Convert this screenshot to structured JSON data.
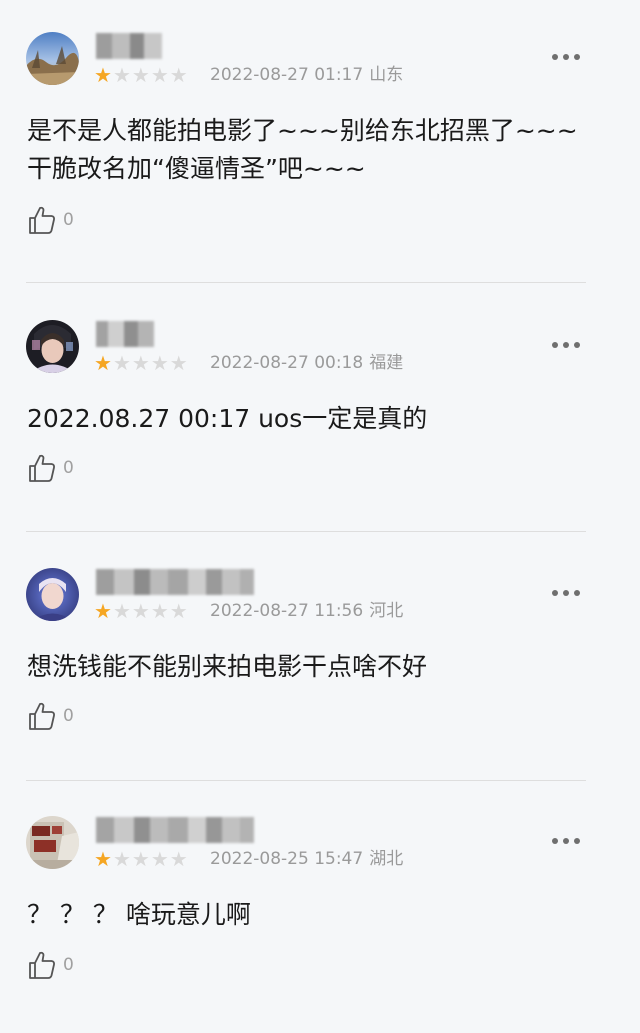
{
  "comments": [
    {
      "rating": 1,
      "date": "2022-08-27 01:17",
      "region": "山东",
      "text": "是不是人都能拍电影了~~~别给东北招黑了~~~\n干脆改名加“傻逼情圣”吧~~~",
      "likes": "0"
    },
    {
      "rating": 1,
      "date": "2022-08-27 00:18",
      "region": "福建",
      "text": "2022.08.27 00:17 uos一定是真的",
      "likes": "0"
    },
    {
      "rating": 1,
      "date": "2022-08-27 11:56",
      "region": "河北",
      "text": "想洗钱能不能别来拍电影干点啥不好",
      "likes": "0"
    },
    {
      "rating": 1,
      "date": "2022-08-25 15:47",
      "region": "湖北",
      "text": "？ ？ ？ 啥玩意儿啊",
      "likes": "0"
    }
  ],
  "colors": {
    "star_on": "#f5a623",
    "star_off": "#d9d9d9",
    "text": "#1a1a1a",
    "meta": "#9a9a9a",
    "background": "#f5f7f9"
  },
  "icons": {
    "more": "more-options-icon",
    "like": "thumbs-up-icon",
    "star": "star-icon"
  }
}
